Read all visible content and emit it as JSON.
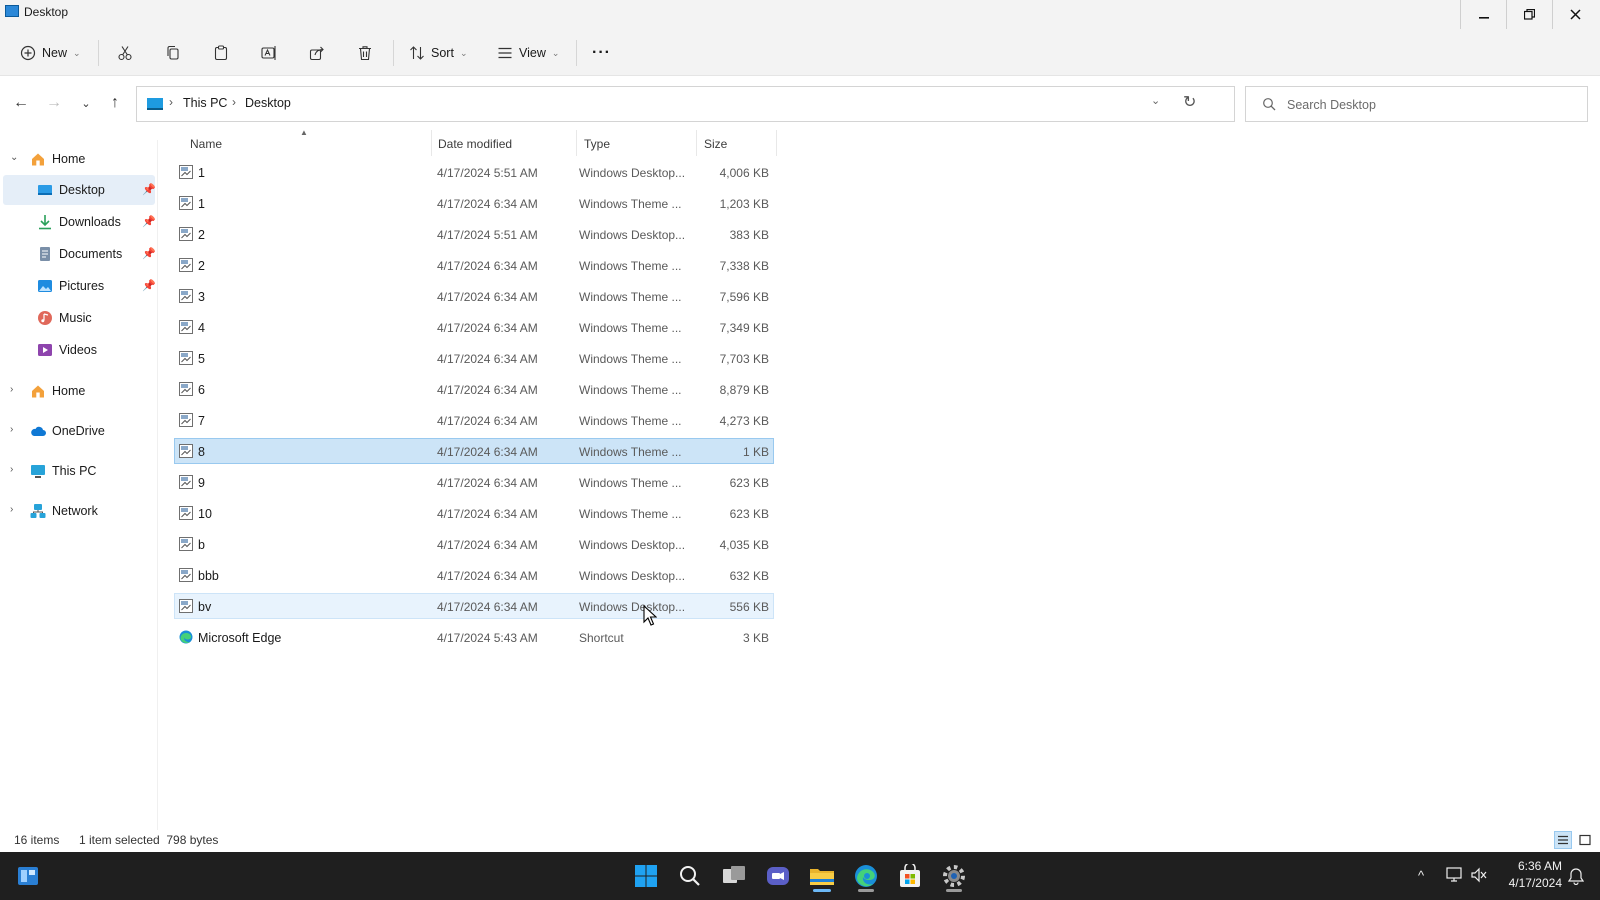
{
  "window": {
    "title": "Desktop",
    "controls": [
      "minimize",
      "restore",
      "close"
    ]
  },
  "toolbar": {
    "new_label": "New",
    "sort_label": "Sort",
    "view_label": "View",
    "more_label": "···"
  },
  "address": {
    "crumbs": [
      "This PC",
      "Desktop"
    ],
    "search_placeholder": "Search Desktop"
  },
  "sidebar": {
    "items": [
      {
        "label": "Home",
        "icon": "home-icon",
        "expanded": true
      },
      {
        "label": "Desktop",
        "icon": "desktop-icon",
        "pinned": true,
        "active": true
      },
      {
        "label": "Downloads",
        "icon": "download-icon",
        "pinned": true
      },
      {
        "label": "Documents",
        "icon": "document-icon",
        "pinned": true
      },
      {
        "label": "Pictures",
        "icon": "picture-icon",
        "pinned": true
      },
      {
        "label": "Music",
        "icon": "music-icon"
      },
      {
        "label": "Videos",
        "icon": "video-icon"
      },
      {
        "label": "Home",
        "icon": "home-icon",
        "expanded": false
      },
      {
        "label": "OneDrive",
        "icon": "cloud-icon",
        "expanded": false
      },
      {
        "label": "This PC",
        "icon": "pc-icon",
        "expanded": false
      },
      {
        "label": "Network",
        "icon": "network-icon",
        "expanded": false
      }
    ]
  },
  "columns": [
    "Name",
    "Date modified",
    "Type",
    "Size"
  ],
  "files": [
    {
      "name": "1",
      "date": "4/17/2024 5:51 AM",
      "type": "Windows Desktop...",
      "size": "4,006 KB"
    },
    {
      "name": "1",
      "date": "4/17/2024 6:34 AM",
      "type": "Windows Theme ...",
      "size": "1,203 KB"
    },
    {
      "name": "2",
      "date": "4/17/2024 5:51 AM",
      "type": "Windows Desktop...",
      "size": "383 KB"
    },
    {
      "name": "2",
      "date": "4/17/2024 6:34 AM",
      "type": "Windows Theme ...",
      "size": "7,338 KB"
    },
    {
      "name": "3",
      "date": "4/17/2024 6:34 AM",
      "type": "Windows Theme ...",
      "size": "7,596 KB"
    },
    {
      "name": "4",
      "date": "4/17/2024 6:34 AM",
      "type": "Windows Theme ...",
      "size": "7,349 KB"
    },
    {
      "name": "5",
      "date": "4/17/2024 6:34 AM",
      "type": "Windows Theme ...",
      "size": "7,703 KB"
    },
    {
      "name": "6",
      "date": "4/17/2024 6:34 AM",
      "type": "Windows Theme ...",
      "size": "8,879 KB"
    },
    {
      "name": "7",
      "date": "4/17/2024 6:34 AM",
      "type": "Windows Theme ...",
      "size": "4,273 KB"
    },
    {
      "name": "8",
      "date": "4/17/2024 6:34 AM",
      "type": "Windows Theme ...",
      "size": "1 KB",
      "state": "selected"
    },
    {
      "name": "9",
      "date": "4/17/2024 6:34 AM",
      "type": "Windows Theme ...",
      "size": "623 KB"
    },
    {
      "name": "10",
      "date": "4/17/2024 6:34 AM",
      "type": "Windows Theme ...",
      "size": "623 KB"
    },
    {
      "name": "b",
      "date": "4/17/2024 6:34 AM",
      "type": "Windows Desktop...",
      "size": "4,035 KB"
    },
    {
      "name": "bbb",
      "date": "4/17/2024 6:34 AM",
      "type": "Windows Desktop...",
      "size": "632 KB"
    },
    {
      "name": "bv",
      "date": "4/17/2024 6:34 AM",
      "type": "Windows Desktop...",
      "size": "556 KB",
      "state": "hover"
    },
    {
      "name": "Microsoft Edge",
      "date": "4/17/2024 5:43 AM",
      "type": "Shortcut",
      "size": "3 KB",
      "icon": "edge-icon"
    }
  ],
  "status": {
    "item_count": "16 items",
    "selection": "1 item selected  798 bytes"
  },
  "taskbar": {
    "apps": [
      "start-icon",
      "search-icon",
      "task-view-icon",
      "chat-icon",
      "file-explorer-icon",
      "edge-icon",
      "store-icon",
      "settings-icon"
    ],
    "active_app": "file-explorer-icon",
    "time": "6:36 AM",
    "date": "4/17/2024"
  },
  "colors": {
    "selection": "#cce4f7",
    "hover": "#e8f3fd",
    "taskbar": "#1f1f1f",
    "accent": "#0078d4"
  }
}
